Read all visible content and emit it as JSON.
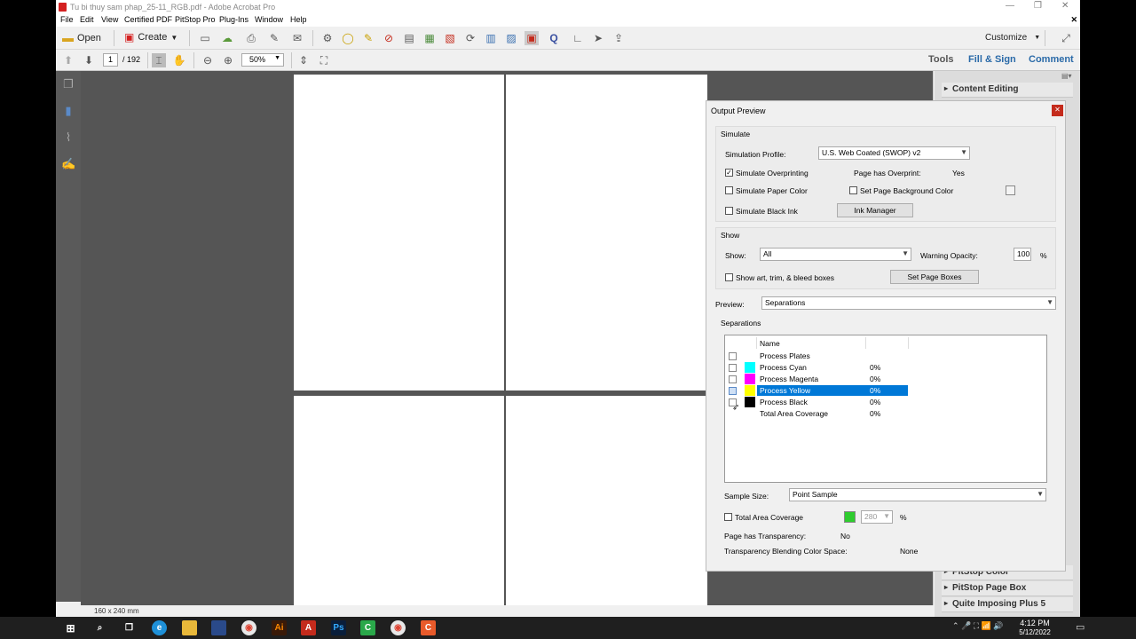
{
  "window": {
    "title": "Tu bi thuy sam phap_25-11_RGB.pdf - Adobe Acrobat Pro"
  },
  "menu": [
    "File",
    "Edit",
    "View",
    "Certified PDF",
    "PitStop Pro",
    "Plug-Ins",
    "Window",
    "Help"
  ],
  "toolbar": {
    "open_label": "Open",
    "create_label": "Create",
    "customize_label": "Customize"
  },
  "nav": {
    "page_current": "1",
    "page_total": "/ 192",
    "zoom": "50%"
  },
  "panes": {
    "tools": "Tools",
    "fill_sign": "Fill & Sign",
    "comment": "Comment"
  },
  "status": {
    "page_size": "160 x 240 mm"
  },
  "right_panel": {
    "top_section": "Content Editing",
    "bottom_sections": [
      "PitStop Color",
      "PitStop Page Box",
      "Quite Imposing Plus 5"
    ]
  },
  "dialog": {
    "title": "Output Preview",
    "simulate": {
      "group_label": "Simulate",
      "profile_label": "Simulation Profile:",
      "profile_value": "U.S. Web Coated (SWOP) v2",
      "overprinting_label": "Simulate Overprinting",
      "overprint_status_label": "Page has Overprint:",
      "overprint_status_value": "Yes",
      "paper_color_label": "Simulate Paper Color",
      "bg_color_label": "Set Page Background Color",
      "black_ink_label": "Simulate Black Ink",
      "ink_manager_label": "Ink Manager"
    },
    "show": {
      "group_label": "Show",
      "show_label": "Show:",
      "show_value": "All",
      "warning_label": "Warning Opacity:",
      "warning_value": "100",
      "warning_unit": "%",
      "boxes_label": "Show art, trim, & bleed boxes",
      "set_boxes_label": "Set Page Boxes"
    },
    "preview": {
      "label": "Preview:",
      "value": "Separations"
    },
    "separations": {
      "group_label": "Separations",
      "name_header": "Name",
      "rows": [
        {
          "name": "Process Plates",
          "pct": "",
          "color": ""
        },
        {
          "name": "Process Cyan",
          "pct": "0%",
          "color": "#00ffff"
        },
        {
          "name": "Process Magenta",
          "pct": "0%",
          "color": "#ff00ff"
        },
        {
          "name": "Process Yellow",
          "pct": "0%",
          "color": "#ffff00"
        },
        {
          "name": "Process Black",
          "pct": "0%",
          "color": "#000000"
        },
        {
          "name": "Total Area Coverage",
          "pct": "0%",
          "color": ""
        }
      ]
    },
    "sample": {
      "label": "Sample Size:",
      "value": "Point Sample"
    },
    "tac": {
      "label": "Total Area Coverage",
      "value": "280",
      "unit": "%"
    },
    "transparency": {
      "label": "Page has Transparency:",
      "value": "No"
    },
    "blending": {
      "label": "Transparency Blending Color Space:",
      "value": "None"
    }
  },
  "taskbar": {
    "time": "4:12 PM",
    "date": "5/12/2022"
  }
}
